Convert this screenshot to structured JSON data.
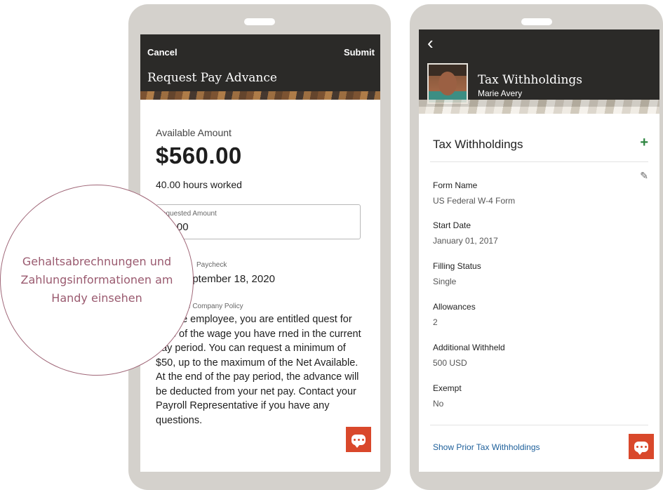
{
  "left_screen": {
    "cancel": "Cancel",
    "submit": "Submit",
    "title": "Request Pay Advance",
    "available_label": "Available Amount",
    "available_amount": "$560.00",
    "hours_worked": "40.00 hours worked",
    "requested_label": "equested Amount",
    "requested_value": "60.00",
    "paycheck_label": "Paycheck",
    "paycheck_date": "eptember 18, 2020",
    "policy_label": "e Company Policy",
    "policy_text": "eligible employee, you are entitled quest for 50% of the wage you have rned in the current pay period. You can request a minimum of $50, up to the maximum of the Net Available. At the end of the pay period, the advance will be deducted from your net pay. Contact your Payroll Representative if you have any questions."
  },
  "right_screen": {
    "header_title": "Tax Withholdings",
    "person_name": "Marie Avery",
    "section_title": "Tax Withholdings",
    "fields": [
      {
        "label": "Form Name",
        "value": "US Federal W-4 Form"
      },
      {
        "label": "Start Date",
        "value": "January 01, 2017"
      },
      {
        "label": "Filling Status",
        "value": "Single"
      },
      {
        "label": "Allowances",
        "value": "2"
      },
      {
        "label": "Additional Withheld",
        "value": "500 USD"
      },
      {
        "label": "Exempt",
        "value": "No"
      }
    ],
    "show_prior": "Show Prior Tax Withholdings"
  },
  "overlay": {
    "text": "Gehaltsabrechnungen und Zahlungsinformationen am Handy einsehen"
  },
  "colors": {
    "header_bg": "#2b2a28",
    "chat_button": "#d9482b",
    "plus_green": "#2e8540",
    "link_blue": "#1d5f9a",
    "overlay_text": "#9a5a6f"
  },
  "icons": [
    "back-chevron-icon",
    "plus-icon",
    "pencil-icon",
    "chat-icon"
  ]
}
